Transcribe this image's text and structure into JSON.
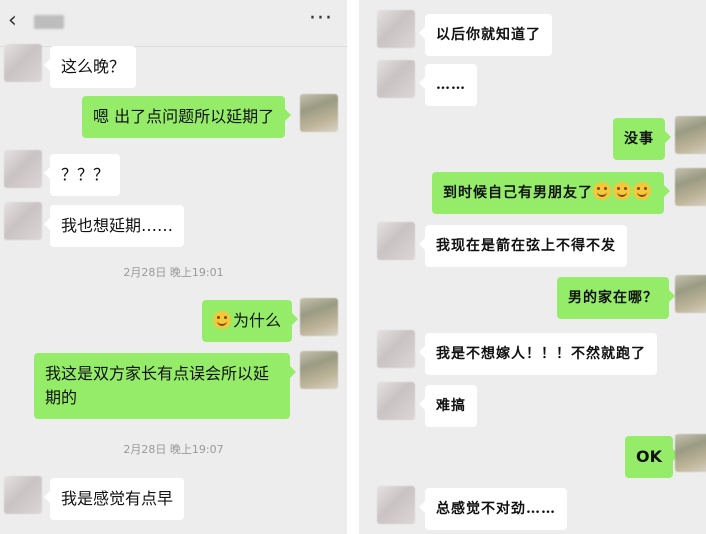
{
  "left": {
    "header": {
      "back_icon": "chevron-left-icon",
      "more_icon": "more-horizontal-icon",
      "more_glyph": "···",
      "name": ""
    },
    "messages": [
      {
        "side": "in",
        "text": "这么晚？"
      },
      {
        "side": "out",
        "text": "嗯 出了点问题所以延期了"
      },
      {
        "side": "in",
        "text": "？？？"
      },
      {
        "side": "in",
        "text": "我也想延期……"
      },
      {
        "side": "out",
        "text": "为什么",
        "emoji": "laughing-face-icon"
      },
      {
        "side": "out",
        "text": "我这是双方家长有点误会所以延期的"
      },
      {
        "side": "in",
        "text": "我是感觉有点早"
      }
    ],
    "timestamps": [
      "2月28日 晚上19:01",
      "2月28日 晚上19:07"
    ]
  },
  "right": {
    "messages": [
      {
        "side": "in",
        "text": "以后你就知道了"
      },
      {
        "side": "in",
        "text": "……"
      },
      {
        "side": "out",
        "text": "没事"
      },
      {
        "side": "out",
        "text": "到时候自己有男朋友了",
        "emoji": "grinning-face-icon"
      },
      {
        "side": "in",
        "text": "我现在是箭在弦上不得不发"
      },
      {
        "side": "out",
        "text": "男的家在哪？"
      },
      {
        "side": "in",
        "text": "我是不想嫁人！！！不然就跑了"
      },
      {
        "side": "in",
        "text": "难搞"
      },
      {
        "side": "out",
        "text": "OK"
      },
      {
        "side": "in",
        "text": "总感觉不对劲……"
      }
    ]
  },
  "colors": {
    "background": "#ededed",
    "incoming_bubble": "#ffffff",
    "outgoing_bubble": "#95ec69",
    "timestamp": "#9a9a9a"
  }
}
